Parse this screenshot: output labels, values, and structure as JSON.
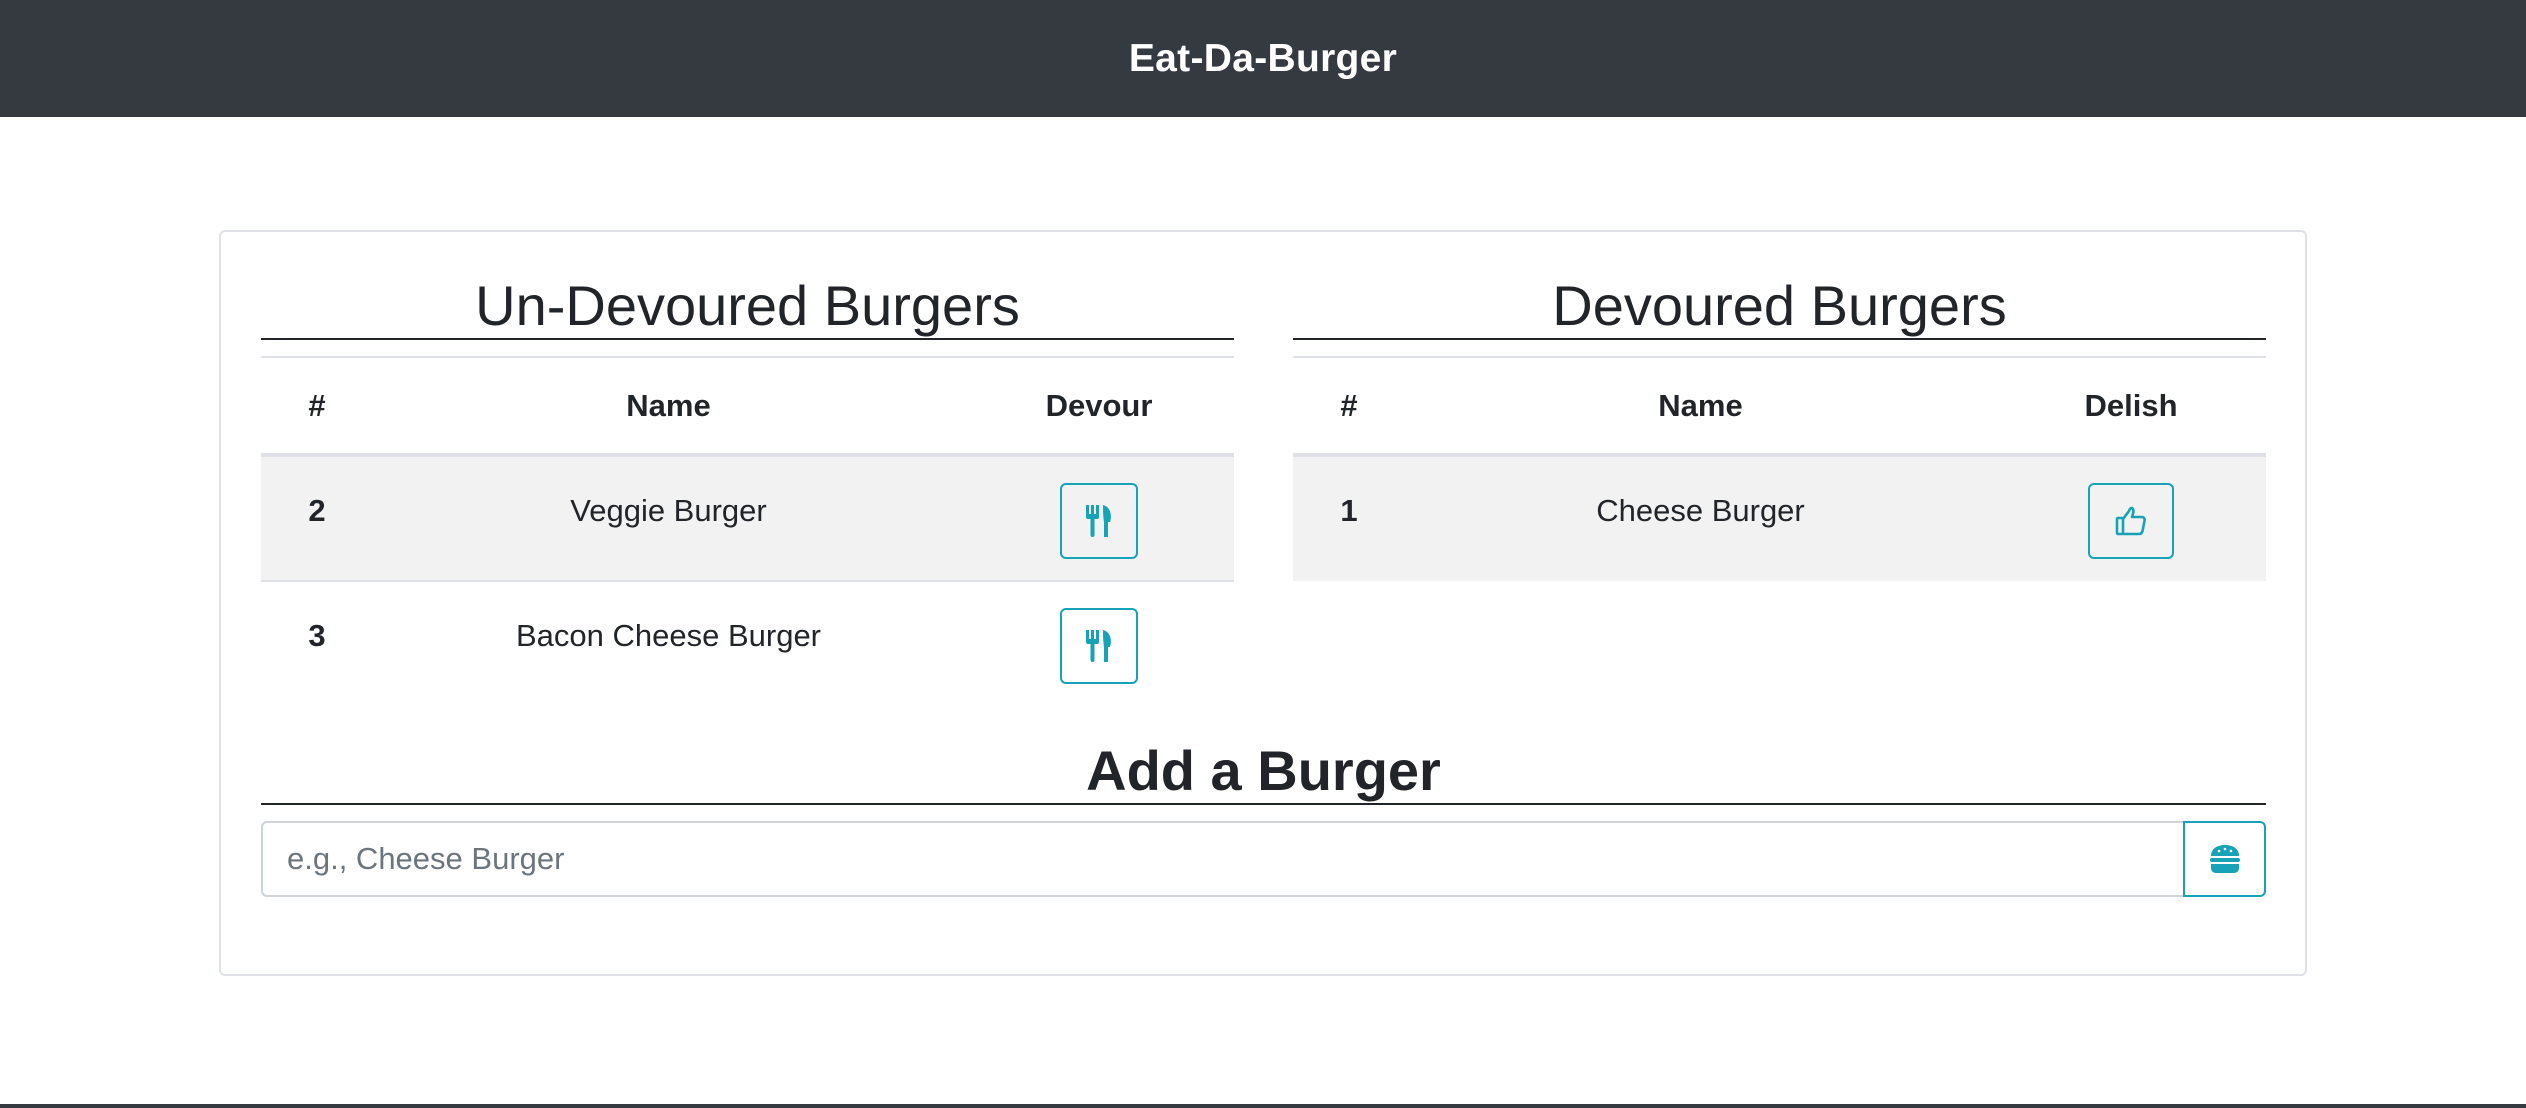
{
  "header": {
    "brand": "Eat-Da-Burger"
  },
  "undevoured": {
    "title": "Un-Devoured Burgers",
    "columns": [
      "#",
      "Name",
      "Devour"
    ],
    "rows": [
      {
        "id": "2",
        "name": "Veggie Burger",
        "action_icon": "utensils-icon"
      },
      {
        "id": "3",
        "name": "Bacon Cheese Burger",
        "action_icon": "utensils-icon"
      }
    ]
  },
  "devoured": {
    "title": "Devoured Burgers",
    "columns": [
      "#",
      "Name",
      "Delish"
    ],
    "rows": [
      {
        "id": "1",
        "name": "Cheese Burger",
        "action_icon": "thumbs-up-icon"
      }
    ]
  },
  "add": {
    "title": "Add a Burger",
    "placeholder": "e.g., Cheese Burger",
    "value": "",
    "submit_icon": "hamburger-icon"
  },
  "colors": {
    "navbar": "#343a40",
    "accent": "#17a2b8",
    "stripe": "#f2f2f2"
  }
}
